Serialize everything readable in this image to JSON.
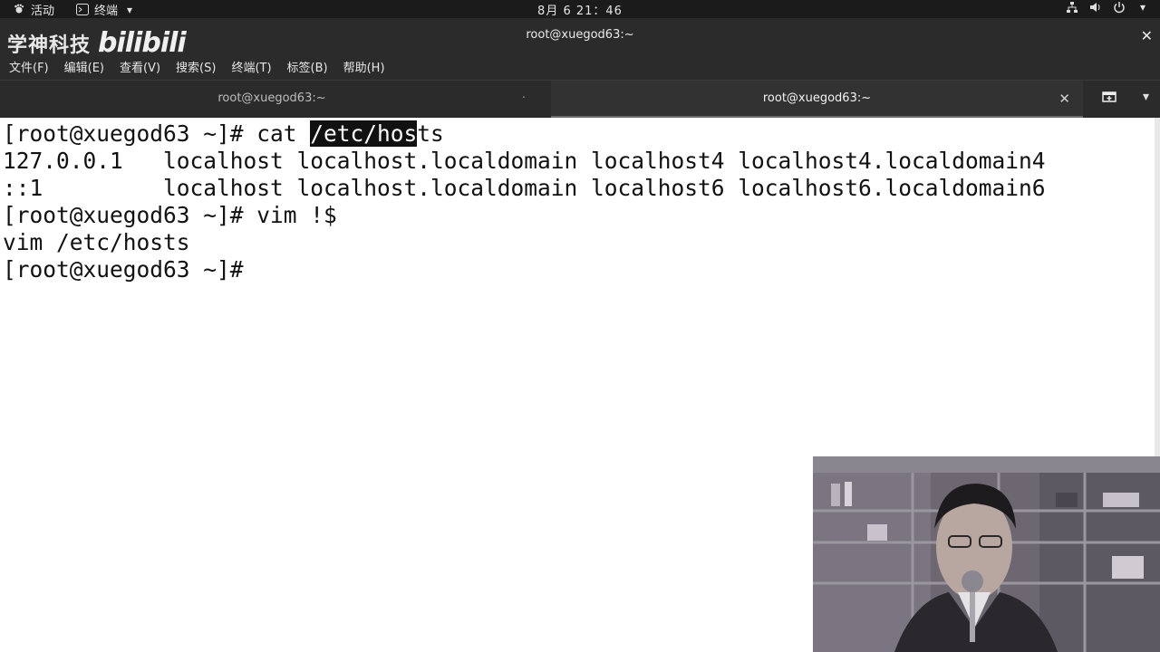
{
  "topbar": {
    "activities": "活动",
    "app_menu": "终端",
    "clock": "8月 6  21：46"
  },
  "window": {
    "title": "root@xuegod63:~",
    "watermark_cn": "学神科技",
    "watermark_bili": "bilibili"
  },
  "menubar": {
    "items": [
      "文件(F)",
      "编辑(E)",
      "查看(V)",
      "搜索(S)",
      "终端(T)",
      "标签(B)",
      "帮助(H)"
    ]
  },
  "tabs": [
    {
      "label": "root@xuegod63:~",
      "active": false
    },
    {
      "label": "root@xuegod63:~",
      "active": true
    }
  ],
  "terminal": {
    "line1": {
      "pre": "[root@xuegod63 ~]# cat ",
      "sel": "/etc/hos",
      "post": "ts"
    },
    "line2": "127.0.0.1   localhost localhost.localdomain localhost4 localhost4.localdomain4",
    "line3": "::1         localhost localhost.localdomain localhost6 localhost6.localdomain6",
    "line4": "[root@xuegod63 ~]# vim !$",
    "line5": "vim /etc/hosts",
    "line6": "[root@xuegod63 ~]#"
  },
  "icons": {
    "activities": "gnome-foot-icon",
    "terminal_app": "terminal-icon",
    "network": "network-icon",
    "volume": "volume-icon",
    "power": "power-icon"
  }
}
